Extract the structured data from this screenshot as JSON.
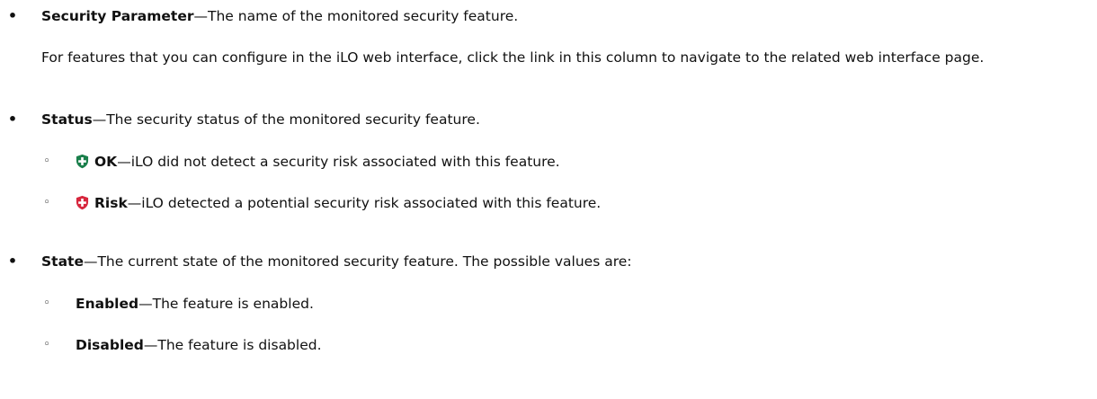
{
  "items": [
    {
      "term": "Security Parameter",
      "description": "—The name of the monitored security feature.",
      "note": "For features that you can configure in the iLO web interface, click the link in this column to navigate to the related web interface page."
    },
    {
      "term": "Status",
      "description": "—The security status of the monitored security feature.",
      "subitems": [
        {
          "term": "OK",
          "description": "—iLO did not detect a security risk associated with this feature.",
          "icon": "shield-ok-icon",
          "color": "#1a7f4b"
        },
        {
          "term": "Risk",
          "description": "—iLO detected a potential security risk associated with this feature.",
          "icon": "shield-risk-icon",
          "color": "#d7263d"
        }
      ]
    },
    {
      "term": "State",
      "description": "—The current state of the monitored security feature. The possible values are:",
      "subitems": [
        {
          "term": "Enabled",
          "description": "—The feature is enabled."
        },
        {
          "term": "Disabled",
          "description": "—The feature is disabled."
        }
      ]
    }
  ],
  "bullet_char": "•",
  "sub_bullet_char": "◦"
}
